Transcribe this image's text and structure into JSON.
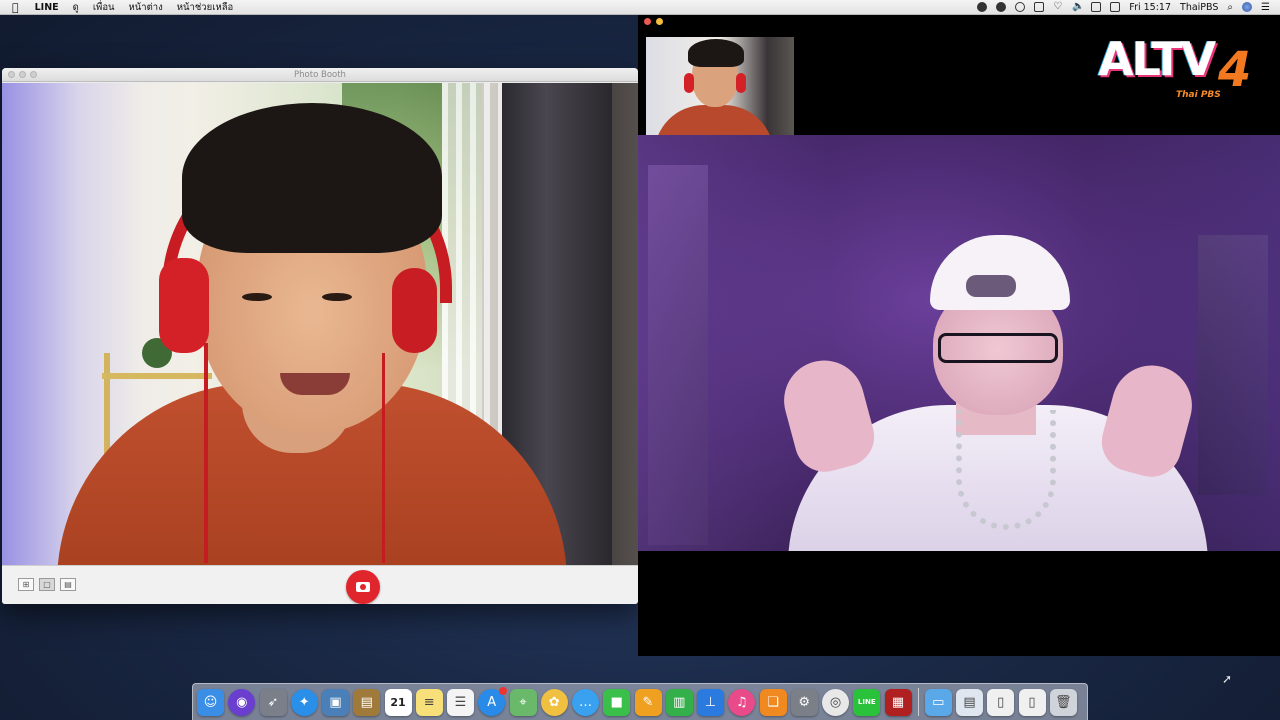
{
  "menubar": {
    "apple_icon": "apple-icon",
    "app_name": "LINE",
    "menus": [
      "ดู",
      "เพื่อน",
      "หน้าต่าง",
      "หน้าช่วยเหลือ"
    ],
    "status_icons": [
      "line-status-icon",
      "chat-status-icon",
      "voice-memo-icon",
      "app-status-icon",
      "heart-icon",
      "volume-icon",
      "keyboard-input-icon",
      "adobe-icon"
    ],
    "clock": "Fri 15:17",
    "user": "ThaiPBS"
  },
  "photo_booth": {
    "title": "Photo Booth",
    "view_buttons": [
      "grid-view",
      "single-view",
      "strip-view"
    ],
    "active_view": "single-view",
    "shutter_icon": "camera-icon",
    "accent": "#e0262c"
  },
  "call_window": {
    "self_view": "self-video",
    "remote_view": "remote-video"
  },
  "channel_logo": {
    "main": "ALTV",
    "number": "4",
    "sub": "Thai PBS",
    "colors": {
      "main": "#ffffff",
      "number": "#f2791f",
      "accent": "#e8357a"
    }
  },
  "dock": {
    "apps": [
      {
        "name": "Finder",
        "icon": "finder-icon",
        "color": "#3a8ee6",
        "glyph": "☺"
      },
      {
        "name": "Siri",
        "icon": "siri-icon",
        "color": "#6a3fd0",
        "glyph": "◉"
      },
      {
        "name": "Launchpad",
        "icon": "launchpad-icon",
        "color": "#7a7f8a",
        "glyph": "➶"
      },
      {
        "name": "Safari",
        "icon": "safari-icon",
        "color": "#2a8fe8",
        "glyph": "✦"
      },
      {
        "name": "Preview",
        "icon": "preview-icon",
        "color": "#4a7fb8",
        "glyph": "▣"
      },
      {
        "name": "Notefile",
        "icon": "notebook-icon",
        "color": "#a07a3a",
        "glyph": "▤"
      },
      {
        "name": "Calendar",
        "icon": "calendar-icon",
        "color": "#ffffff",
        "glyph": "21"
      },
      {
        "name": "Notes",
        "icon": "notes-icon",
        "color": "#f7e07a",
        "glyph": "≡"
      },
      {
        "name": "Reminders",
        "icon": "reminders-icon",
        "color": "#f4f4f4",
        "glyph": "☰"
      },
      {
        "name": "App Store",
        "icon": "app-store-icon",
        "color": "#2a8ae8",
        "glyph": "A"
      },
      {
        "name": "Maps",
        "icon": "maps-icon",
        "color": "#6ab86a",
        "glyph": "⌖"
      },
      {
        "name": "Photos",
        "icon": "photos-icon",
        "color": "#f0c040",
        "glyph": "✿"
      },
      {
        "name": "Messages",
        "icon": "messages-icon",
        "color": "#3aa0f0",
        "glyph": "…"
      },
      {
        "name": "FaceTime",
        "icon": "facetime-icon",
        "color": "#3ac04a",
        "glyph": "■"
      },
      {
        "name": "Pages",
        "icon": "pages-icon",
        "color": "#f0a020",
        "glyph": "✎"
      },
      {
        "name": "Numbers",
        "icon": "numbers-icon",
        "color": "#34b04a",
        "glyph": "▥"
      },
      {
        "name": "Keynote",
        "icon": "keynote-icon",
        "color": "#2a7ae0",
        "glyph": "⊥"
      },
      {
        "name": "iTunes",
        "icon": "itunes-icon",
        "color": "#e84a8a",
        "glyph": "♫"
      },
      {
        "name": "iBooks",
        "icon": "ibooks-icon",
        "color": "#f08a20",
        "glyph": "❏"
      },
      {
        "name": "System Preferences",
        "icon": "settings-icon",
        "color": "#7a7f88",
        "glyph": "⚙"
      },
      {
        "name": "Chrome",
        "icon": "chrome-icon",
        "color": "#e8e8e8",
        "glyph": "◎"
      },
      {
        "name": "LINE",
        "icon": "line-icon",
        "color": "#2ac23a",
        "glyph": "LINE"
      },
      {
        "name": "Photo Booth",
        "icon": "photo-booth-icon",
        "color": "#b02020",
        "glyph": "▦"
      }
    ],
    "right_items": [
      {
        "name": "Downloads",
        "icon": "folder-icon",
        "color": "#5aa8e8",
        "glyph": "▭"
      },
      {
        "name": "Mail drafts",
        "icon": "document-stack-icon",
        "color": "#dfe6f0",
        "glyph": "▤"
      },
      {
        "name": "Document",
        "icon": "document-icon",
        "color": "#f0f0f0",
        "glyph": "▯"
      },
      {
        "name": "Document 2",
        "icon": "document2-icon",
        "color": "#f0f0f0",
        "glyph": "▯"
      },
      {
        "name": "Trash",
        "icon": "trash-icon",
        "color": "#cfd4da",
        "glyph": "🗑"
      }
    ]
  }
}
